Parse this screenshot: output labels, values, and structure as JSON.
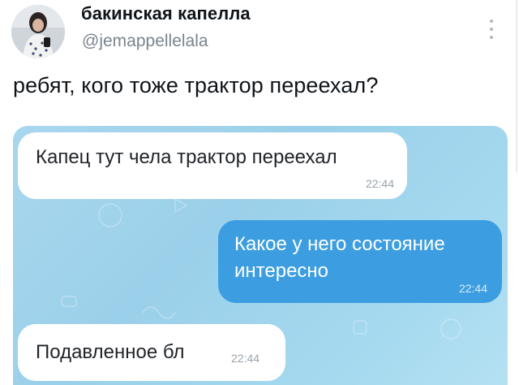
{
  "tweet": {
    "display_name": "бакинская капелла",
    "handle": "@jemappellelala",
    "text": "ребят, кого тоже трактор переехал?"
  },
  "chat": {
    "messages": [
      {
        "direction": "incoming",
        "text": "Капец тут чела трактор переехал",
        "time": "22:44"
      },
      {
        "direction": "outgoing",
        "text": "Какое у него состояние интересно",
        "time": "22:44"
      },
      {
        "direction": "incoming",
        "text": "Подавленное бл",
        "time": "22:44"
      }
    ]
  },
  "icons": {
    "more": "more-vertical-icon",
    "avatar": "avatar"
  },
  "colors": {
    "outgoing_bubble": "#3c9ee0",
    "incoming_bubble": "#ffffff",
    "chat_background": "#a4d9ef",
    "handle_text": "#7a848d"
  }
}
